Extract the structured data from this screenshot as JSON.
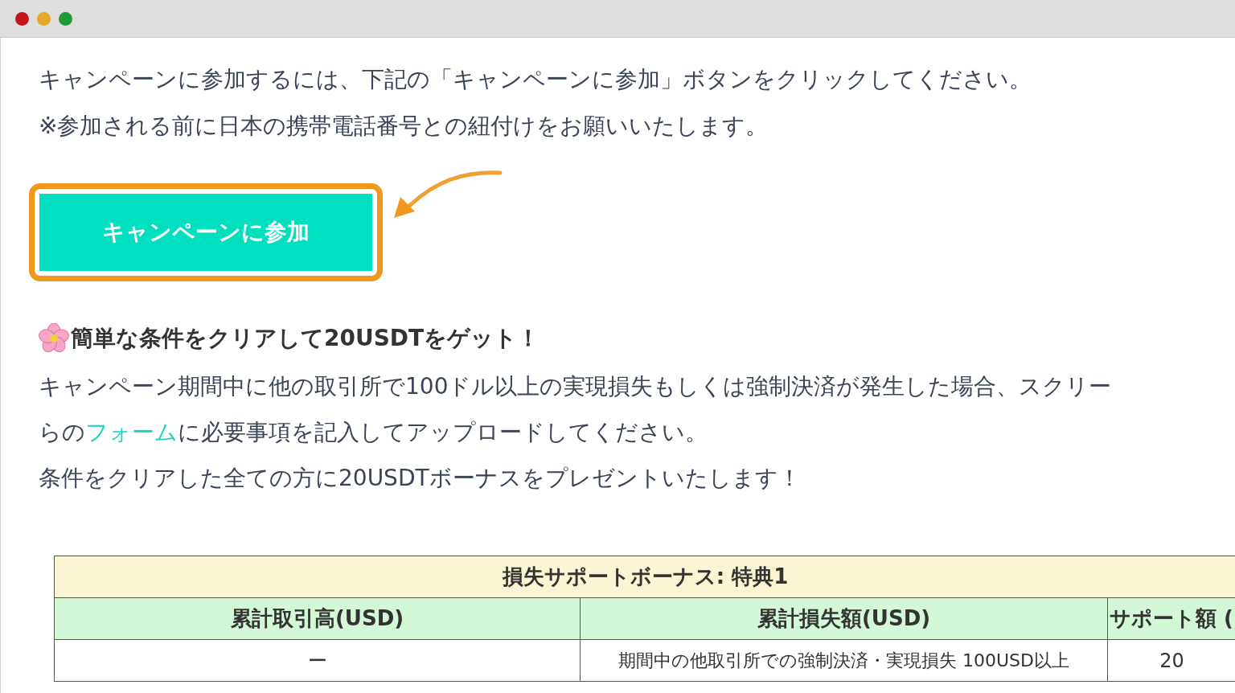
{
  "window": {
    "controls": [
      {
        "color": "#c4161c"
      },
      {
        "color": "#e2a92b"
      },
      {
        "color": "#1e9d37"
      }
    ]
  },
  "intro": [
    "キャンペーンに参加するには、下記の「キャンペーンに参加」ボタンをクリックしてください。",
    "※参加される前に日本の携帯電話番号との紐付けをお願いいたします。"
  ],
  "join_button": {
    "label": "キャンペーンに参加",
    "highlighted": true
  },
  "bonus": {
    "heading": "簡単な条件をクリアして20USDTをゲット！",
    "lines": [
      {
        "text": "キャンペーン期間中に他の取引所で100ドル以上の実現損失もしくは強制決済が発生した場合、スクリー"
      },
      {
        "before": "らの",
        "link": "フォーム",
        "after": "に必要事項を記入してアップロードしてください。"
      },
      {
        "text": "条件をクリアした全ての方に20USDTボーナスをプレゼントいたします！"
      }
    ]
  },
  "table": {
    "title": "損失サポートボーナス: 特典1",
    "columns": [
      "累計取引高(USD)",
      "累計損失額(USD)",
      "サポート額 ("
    ],
    "rows": [
      [
        "ー",
        "期間中の他取引所での強制決済・実現損失 100USD以上",
        "20"
      ]
    ]
  }
}
